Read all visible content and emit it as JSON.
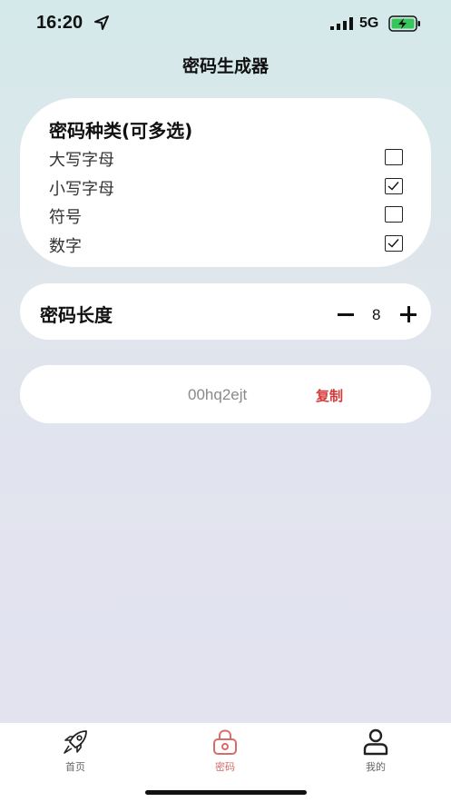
{
  "status_bar": {
    "time": "16:20",
    "network": "5G",
    "icons": [
      "location-arrow-icon",
      "signal-icon",
      "battery-charging-icon"
    ]
  },
  "page": {
    "title": "密码生成器"
  },
  "password_types": {
    "title": "密码种类(可多选)",
    "options": [
      {
        "label": "大写字母",
        "checked": false
      },
      {
        "label": "小写字母",
        "checked": true
      },
      {
        "label": "符号",
        "checked": false
      },
      {
        "label": "数字",
        "checked": true
      }
    ]
  },
  "password_length": {
    "label": "密码长度",
    "value": "8",
    "decrement_icon": "minus-icon",
    "increment_icon": "plus-icon"
  },
  "result": {
    "password": "00hq2ejt",
    "copy_label": "复制"
  },
  "tab_bar": {
    "active_tab": "密码",
    "tabs": [
      {
        "label": "首页",
        "icon": "rocket-icon"
      },
      {
        "label": "密码",
        "icon": "lock-icon"
      },
      {
        "label": "我的",
        "icon": "person-icon"
      }
    ]
  },
  "colors": {
    "accent_red": "#d63a3a",
    "active_tab": "#d96b6b",
    "card_bg": "#ffffff"
  }
}
